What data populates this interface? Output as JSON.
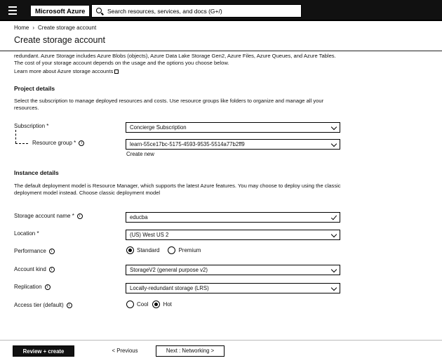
{
  "header": {
    "brand": "Microsoft Azure",
    "search_placeholder": "Search resources, services, and docs (G+/)"
  },
  "breadcrumb": {
    "home": "Home",
    "current": "Create storage account"
  },
  "page_title": "Create storage account",
  "intro": {
    "text": "redundant. Azure Storage includes Azure Blobs (objects), Azure Data Lake Storage Gen2, Azure Files, Azure Queues, and Azure Tables. The cost of your storage account depends on the usage and the options you choose below.",
    "link": "Learn more about Azure storage accounts"
  },
  "project_details": {
    "title": "Project details",
    "description": "Select the subscription to manage deployed resources and costs. Use resource groups like folders to organize and manage all your resources.",
    "subscription_label": "Subscription *",
    "subscription_value": "Concierge Subscription",
    "resource_group_label": "Resource group *",
    "resource_group_value": "learn-55ce17bc-5175-4593-9535-5514a77b2ff9",
    "create_new": "Create new"
  },
  "instance_details": {
    "title": "Instance details",
    "description": "The default deployment model is Resource Manager, which supports the latest Azure features. You may choose to deploy using the classic deployment model instead.",
    "classic_link": "Choose classic deployment model",
    "storage_name_label": "Storage account name *",
    "storage_name_value": "educba",
    "location_label": "Location *",
    "location_value": "(US) West US 2",
    "performance_label": "Performance",
    "performance_options": [
      "Standard",
      "Premium"
    ],
    "performance_selected": "Standard",
    "account_kind_label": "Account kind",
    "account_kind_value": "StorageV2 (general purpose v2)",
    "replication_label": "Replication",
    "replication_value": "Locally-redundant storage (LRS)",
    "access_tier_label": "Access tier (default)",
    "access_tier_options": [
      "Cool",
      "Hot"
    ],
    "access_tier_selected": "Hot"
  },
  "footer": {
    "review_create": "Review + create",
    "previous": "< Previous",
    "next": "Next : Networking >"
  }
}
